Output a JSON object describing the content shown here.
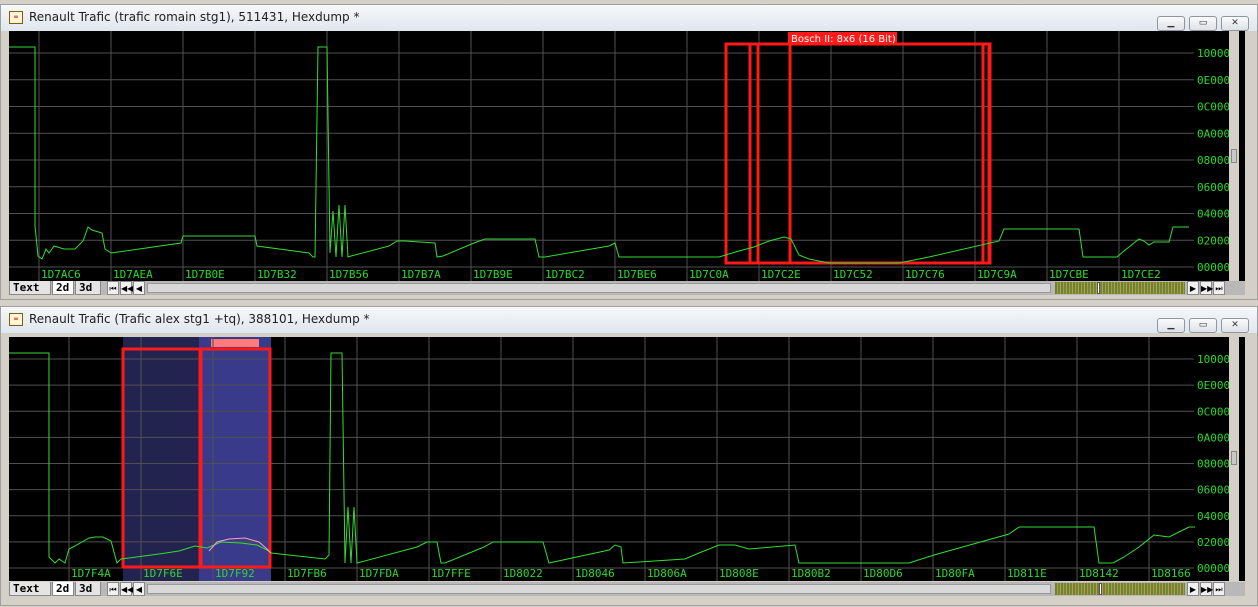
{
  "windows": [
    {
      "title": "Renault Trafic (trafic romain stg1), 511431, Hexdump *",
      "y_labels": [
        "10000",
        "0E000",
        "0C000",
        "0A000",
        "08000",
        "06000",
        "04000",
        "02000",
        "00000"
      ],
      "x_labels": [
        "1D7AC6",
        "1D7AEA",
        "1D7B0E",
        "1D7B32",
        "1D7B56",
        "1D7B7A",
        "1D7B9E",
        "1D7BC2",
        "1D7BE6",
        "1D7C0A",
        "1D7C2E",
        "1D7C52",
        "1D7C76",
        "1D7C9A",
        "1D7CBE",
        "1D7CE2"
      ],
      "map_label": "Bosch II: 8x6 (16 Bit)",
      "tabs": [
        "Text",
        "2d",
        "3d"
      ],
      "active_tab": "2d"
    },
    {
      "title": "Renault Trafic (Trafic alex stg1 +tq), 388101, Hexdump *",
      "y_labels": [
        "10000",
        "0E000",
        "0C000",
        "0A000",
        "08000",
        "06000",
        "04000",
        "02000",
        "00000"
      ],
      "x_labels": [
        "1D7F4A",
        "1D7F6E",
        "1D7F92",
        "1D7FB6",
        "1D7FDA",
        "1D7FFE",
        "1D8022",
        "1D8046",
        "1D806A",
        "1D808E",
        "1D80B2",
        "1D80D6",
        "1D80FA",
        "1D811E",
        "1D8142",
        "1D8166"
      ],
      "tabs": [
        "Text",
        "2d",
        "3d"
      ],
      "active_tab": "2d"
    }
  ],
  "colors": {
    "plot_bg": "#000000",
    "grid": "#505050",
    "trace": "#33dd33",
    "selection": "#ff1a1a",
    "highlight": "#3a3a8a",
    "axis_text": "#2bd92b"
  },
  "icons": {
    "minimize": "minimize-icon",
    "maximize": "maximize-icon",
    "close": "close-icon",
    "nav_first": "nav-first-icon",
    "nav_prev_fast": "nav-prev-fast-icon",
    "nav_prev": "nav-prev-icon",
    "nav_next": "nav-next-icon",
    "nav_next_fast": "nav-next-fast-icon",
    "nav_last": "nav-last-icon"
  }
}
